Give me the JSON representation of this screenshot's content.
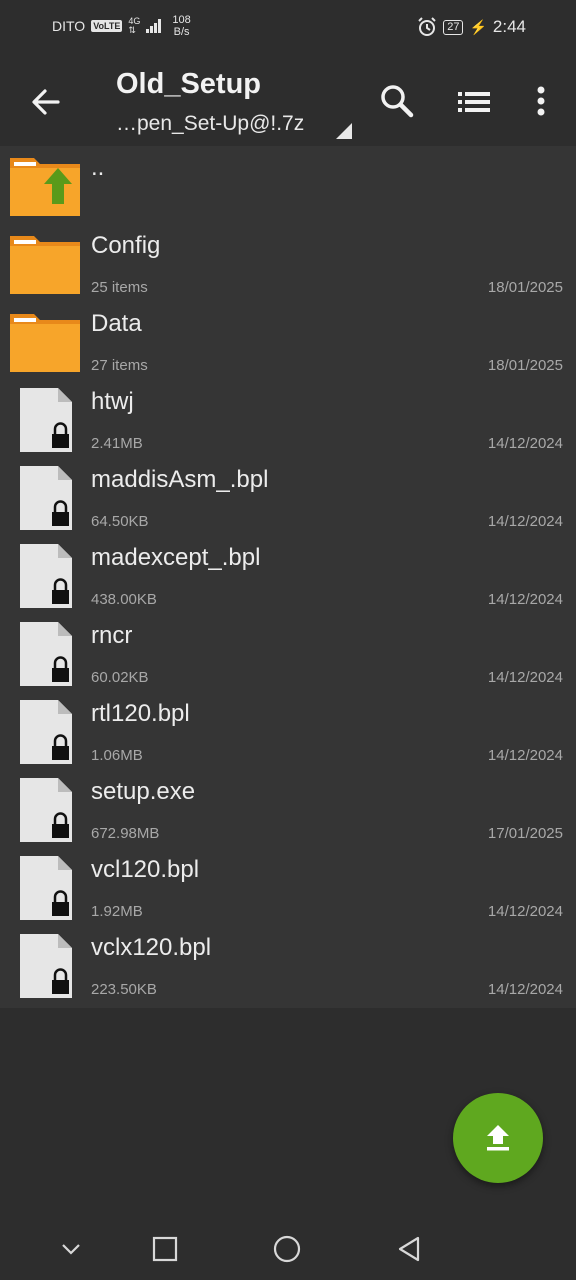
{
  "status": {
    "carrier": "DITO",
    "volte": "VoLTE",
    "network": "4G",
    "speed_value": "108",
    "speed_unit": "B/s",
    "battery": "27",
    "time": "2:44"
  },
  "appbar": {
    "title": "Old_Setup",
    "subtitle": "…pen_Set-Up@!.7z"
  },
  "files": [
    {
      "name": "..",
      "meta": "",
      "date": "",
      "type": "parent"
    },
    {
      "name": "Config",
      "meta": "25 items",
      "date": "18/01/2025",
      "type": "folder"
    },
    {
      "name": "Data",
      "meta": "27 items",
      "date": "18/01/2025",
      "type": "folder"
    },
    {
      "name": "htwj",
      "meta": "2.41MB",
      "date": "14/12/2024",
      "type": "locked-file"
    },
    {
      "name": "maddisAsm_.bpl",
      "meta": "64.50KB",
      "date": "14/12/2024",
      "type": "locked-file"
    },
    {
      "name": "madexcept_.bpl",
      "meta": "438.00KB",
      "date": "14/12/2024",
      "type": "locked-file"
    },
    {
      "name": "rncr",
      "meta": "60.02KB",
      "date": "14/12/2024",
      "type": "locked-file"
    },
    {
      "name": "rtl120.bpl",
      "meta": "1.06MB",
      "date": "14/12/2024",
      "type": "locked-file"
    },
    {
      "name": "setup.exe",
      "meta": "672.98MB",
      "date": "17/01/2025",
      "type": "locked-file"
    },
    {
      "name": "vcl120.bpl",
      "meta": "1.92MB",
      "date": "14/12/2024",
      "type": "locked-file"
    },
    {
      "name": "vclx120.bpl",
      "meta": "223.50KB",
      "date": "14/12/2024",
      "type": "locked-file"
    }
  ],
  "colors": {
    "background": "#2d2d2d",
    "list_background": "#353535",
    "folder": "#f7a52a",
    "fab": "#5fa81f",
    "up_arrow": "#5a9a1a"
  },
  "icons": {
    "back": "arrow-left-icon",
    "search": "search-icon",
    "view": "list-view-icon",
    "more": "more-vert-icon",
    "fab": "upload-icon"
  }
}
